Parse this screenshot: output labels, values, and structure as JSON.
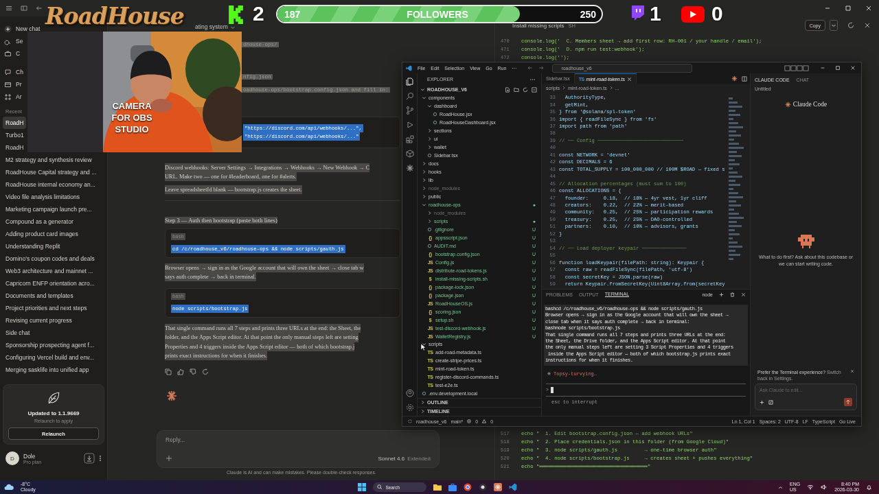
{
  "overlay": {
    "logo": "RoadHouse",
    "camera_label": "CAMERA FOR OBS STUDIO",
    "kick_count": "2",
    "followers": {
      "current": "187",
      "label": "FOLLOWERS",
      "goal": "250",
      "level": 0.748
    },
    "twitch_count": "1",
    "youtube_count": "0"
  },
  "claude": {
    "sidebar": {
      "new_chat": "New chat",
      "nav": [
        "Se",
        "C",
        "Ch",
        "Pr",
        "Ar"
      ],
      "recents_label": "Recent",
      "recents": [
        {
          "title": "RoadH",
          "selected": true
        },
        {
          "title": "Turbo1",
          "selected": false
        },
        {
          "title": "RoadH",
          "selected": false
        },
        {
          "title": "M2 strategy and synthesis review",
          "selected": false
        },
        {
          "title": "RoadHouse Capital strategy and ...",
          "selected": false
        },
        {
          "title": "RoadHouse internal economy an...",
          "selected": false
        },
        {
          "title": "Video file analysis limitations",
          "selected": false
        },
        {
          "title": "Marketing campaign launch pre...",
          "selected": false
        },
        {
          "title": "Compound as a generator",
          "selected": false
        },
        {
          "title": "Adding product card images",
          "selected": false
        },
        {
          "title": "Understanding Replit",
          "selected": false
        },
        {
          "title": "Domino's coupon codes and deals",
          "selected": false
        },
        {
          "title": "Web3 architecture and mainnet ...",
          "selected": false
        },
        {
          "title": "Capricorn ENFP orientation acro...",
          "selected": false
        },
        {
          "title": "Documents and templates",
          "selected": false
        },
        {
          "title": "Project priorities and next steps",
          "selected": false
        },
        {
          "title": "Revising current progress",
          "selected": false
        },
        {
          "title": "Side chat",
          "selected": false
        },
        {
          "title": "Sponsorship prospecting agent f...",
          "selected": false
        },
        {
          "title": "Configuring Vercel build and env...",
          "selected": false
        },
        {
          "title": "Merging sasklife into unified app",
          "selected": false
        }
      ],
      "update": {
        "title": "Updated to 1.1.9669",
        "subtitle": "Relaunch to apply",
        "button": "Relaunch"
      },
      "user": {
        "initial": "D",
        "name": "Dole",
        "plan": "Pro plan"
      }
    },
    "chat": {
      "title": "ating system",
      "blocks": [
        {
          "kind": "chip",
          "text": "dhouse-ops/"
        },
        {
          "kind": "chip",
          "text": "nfig.json"
        },
        {
          "kind": "chip",
          "text": "oadhouse-ops/bootstrap.config.json and fill in:"
        },
        {
          "kind": "code",
          "lines": [
            "\"https://discord.com/api/webhooks/...\",",
            "\"https://discord.com/api/webhooks/...\""
          ]
        },
        {
          "kind": "para",
          "lines": [
            "Discord webhooks: Server Settings → Integrations → Webhooks → New Webhook → C",
            "URL. Make two — one for #leaderboard, one for #alerts."
          ]
        },
        {
          "kind": "para",
          "lines": [
            "Leave spreadsheetId blank — bootstrap.js creates the sheet."
          ]
        },
        {
          "kind": "rule"
        },
        {
          "kind": "heading",
          "text": "Step 3 — Auth then bootstrap (paste both lines)"
        },
        {
          "kind": "code",
          "label": "bash",
          "lines": [
            "cd /c/roadhouse_v6/roadhouse-ops && node scripts/gauth.js"
          ]
        },
        {
          "kind": "para",
          "lines": [
            "Browser opens → sign in as the Google account that will own the sheet → close tab w",
            "says auth complete → back in terminal."
          ]
        },
        {
          "kind": "code",
          "label": "bash",
          "lines": [
            "node scripts/bootstrap.js"
          ]
        },
        {
          "kind": "para",
          "lines": [
            "That single command runs all 7 steps and prints three URLs at the end: the Sheet, the",
            "folder, and the Apps Script editor. At that point the only manual steps left are setting",
            "Properties and 4 triggers inside the Apps Script editor — both of which bootstrap.j",
            "prints exact instructions for when it finishes."
          ]
        }
      ],
      "reply_placeholder": "Reply...",
      "model": "Sonnet 4.6",
      "mode": "Extended",
      "disclaimer": "Claude is AI and can make mistakes. Please double-check responses."
    },
    "artifact": {
      "title": "Install missing scripts",
      "type": "SH",
      "copy": "Copy",
      "top_lines": [
        {
          "no": "470",
          "text": "console.log('  C. Members sheet → add first row: RH-001 / your handle / email');"
        },
        {
          "no": "471",
          "text": "console.log('  D. npm run test:webhook');"
        },
        {
          "no": "472",
          "text": "console.log('');"
        }
      ],
      "bottom_lines": [
        {
          "no": "517",
          "text": "echo \"  1. Edit bootstrap.config.json — add webhook URLs\""
        },
        {
          "no": "518",
          "text": "echo \"  2. Place credentials.json in this folder (from Google Cloud)\""
        },
        {
          "no": "519",
          "text": "echo \"  3. node scripts/gauth.js         → one-time browser auth\""
        },
        {
          "no": "520",
          "text": "echo \"  4. node scripts/bootstrap.js     → creates sheet + pushes everything\""
        },
        {
          "no": "521",
          "text": "echo \"════════════════════════════════════\""
        }
      ]
    }
  },
  "vscode": {
    "menu": [
      "File",
      "Edit",
      "Selection",
      "View",
      "Go",
      "Run",
      "···"
    ],
    "search": "roadhouse_v6",
    "explorer": {
      "title": "EXPLORER",
      "root": "ROADHOUSE_V6",
      "sections": [
        "OUTLINE",
        "TIMELINE"
      ],
      "tree": [
        {
          "name": "components",
          "kind": "folder",
          "expanded": true,
          "untracked": false,
          "ignored": false,
          "children": [
            {
              "name": "dashboard",
              "kind": "folder",
              "expanded": true,
              "untracked": false,
              "ignored": false,
              "children": [
                {
                  "name": "RoadHouse.jsx",
                  "kind": "file",
                  "untracked": false,
                  "ignored": false
                },
                {
                  "name": "RoadHouseDashboard.jsx",
                  "kind": "file",
                  "untracked": false,
                  "ignored": false
                }
              ]
            },
            {
              "name": "sections",
              "kind": "folder",
              "expanded": false,
              "untracked": false,
              "ignored": false
            },
            {
              "name": "ui",
              "kind": "folder",
              "expanded": false,
              "untracked": false,
              "ignored": false
            },
            {
              "name": "wallet",
              "kind": "folder",
              "expanded": false,
              "untracked": false,
              "ignored": false
            },
            {
              "name": "Sidebar.tsx",
              "kind": "file",
              "untracked": false,
              "ignored": false
            }
          ]
        },
        {
          "name": "docs",
          "kind": "folder",
          "expanded": false,
          "untracked": false,
          "ignored": false
        },
        {
          "name": "hooks",
          "kind": "folder",
          "expanded": false,
          "untracked": false,
          "ignored": false
        },
        {
          "name": "lib",
          "kind": "folder",
          "expanded": false,
          "untracked": false,
          "ignored": false
        },
        {
          "name": "node_modules",
          "kind": "folder",
          "expanded": false,
          "untracked": false,
          "ignored": true
        },
        {
          "name": "public",
          "kind": "folder",
          "expanded": false,
          "untracked": false,
          "ignored": false
        },
        {
          "name": "roadhouse-ops",
          "kind": "folder",
          "expanded": true,
          "untracked": true,
          "ignored": false,
          "decoration": "●",
          "children": [
            {
              "name": "node_modules",
              "kind": "folder",
              "expanded": false,
              "untracked": false,
              "ignored": true
            },
            {
              "name": "scripts",
              "kind": "folder",
              "expanded": false,
              "untracked": true,
              "ignored": false,
              "decoration": "●"
            },
            {
              "name": ".gitignore",
              "kind": "file",
              "untracked": true,
              "ignored": false,
              "decoration": "U"
            },
            {
              "name": "appsscript.json",
              "kind": "file",
              "badge": "{}",
              "untracked": true,
              "ignored": false,
              "decoration": "U"
            },
            {
              "name": "AUDIT.md",
              "kind": "file",
              "untracked": true,
              "ignored": false,
              "decoration": "U"
            },
            {
              "name": "bootstrap.config.json",
              "kind": "file",
              "badge": "{}",
              "untracked": true,
              "ignored": false,
              "decoration": "U"
            },
            {
              "name": "Config.js",
              "kind": "file",
              "badge": "JS",
              "untracked": true,
              "ignored": false,
              "decoration": "U"
            },
            {
              "name": "distribute-road-tokens.js",
              "kind": "file",
              "badge": "JS",
              "untracked": true,
              "ignored": false,
              "decoration": "U"
            },
            {
              "name": "install-missing-scripts.sh",
              "kind": "file",
              "badge": "$",
              "untracked": true,
              "ignored": false,
              "decoration": "U"
            },
            {
              "name": "package-lock.json",
              "kind": "file",
              "badge": "{}",
              "untracked": true,
              "ignored": false,
              "decoration": "U"
            },
            {
              "name": "package.json",
              "kind": "file",
              "badge": "{}",
              "untracked": true,
              "ignored": false,
              "decoration": "U"
            },
            {
              "name": "RoadHouseOS.js",
              "kind": "file",
              "badge": "JS",
              "untracked": true,
              "ignored": false,
              "decoration": "U"
            },
            {
              "name": "scoring.json",
              "kind": "file",
              "badge": "{}",
              "untracked": true,
              "ignored": false,
              "decoration": "U"
            },
            {
              "name": "setup.sh",
              "kind": "file",
              "badge": "$",
              "untracked": true,
              "ignored": false,
              "decoration": "U"
            },
            {
              "name": "test-discord-webhook.js",
              "kind": "file",
              "badge": "JS",
              "untracked": true,
              "ignored": false,
              "decoration": "U"
            },
            {
              "name": "WalletRegistry.js",
              "kind": "file",
              "badge": "JS",
              "untracked": true,
              "ignored": false,
              "decoration": "U"
            }
          ]
        },
        {
          "name": "scripts",
          "kind": "folder",
          "expanded": true,
          "untracked": false,
          "ignored": false,
          "children": [
            {
              "name": "add-road-metadata.ts",
              "kind": "file",
              "badge": "TS",
              "untracked": false,
              "ignored": false
            },
            {
              "name": "create-stripe-prices.ts",
              "kind": "file",
              "badge": "TS",
              "untracked": false,
              "ignored": false
            },
            {
              "name": "mint-road-token.ts",
              "kind": "file",
              "badge": "TS",
              "untracked": false,
              "ignored": false
            },
            {
              "name": "register-discord-commands.ts",
              "kind": "file",
              "badge": "TS",
              "untracked": false,
              "ignored": false
            },
            {
              "name": "test-e2e.ts",
              "kind": "file",
              "badge": "TS",
              "untracked": false,
              "ignored": false
            }
          ]
        },
        {
          "name": ".env.development.local",
          "kind": "file",
          "untracked": false,
          "ignored": false
        }
      ]
    },
    "tabs": [
      {
        "label": "Sidebar.tsx",
        "selected": false
      },
      {
        "label": "mint-road-token.ts",
        "badge": "TS",
        "selected": true
      }
    ],
    "breadcrumb": [
      "scripts",
      "mint-road-token.ts",
      "..."
    ],
    "code": [
      {
        "no": "33",
        "kind": "code",
        "text": "  AuthorityType,"
      },
      {
        "no": "34",
        "kind": "code",
        "text": "  getMint,"
      },
      {
        "no": "35",
        "kind": "code",
        "text": "} from '@solana/spl-token'"
      },
      {
        "no": "36",
        "kind": "code",
        "text": "import { readFileSync } from 'fs'"
      },
      {
        "no": "37",
        "kind": "code",
        "text": "import path from 'path'"
      },
      {
        "no": "38",
        "kind": "blank"
      },
      {
        "no": "39",
        "kind": "comment",
        "text": "// ── Config ─────────────────────────────"
      },
      {
        "no": "40",
        "kind": "blank"
      },
      {
        "no": "41",
        "kind": "code",
        "text": "const NETWORK = 'devnet'"
      },
      {
        "no": "42",
        "kind": "code",
        "text": "const DECIMALS = 6"
      },
      {
        "no": "43",
        "kind": "code",
        "text": "const TOTAL_SUPPLY = 100_000_000 // 100M $ROAD — fixed s"
      },
      {
        "no": "44",
        "kind": "blank"
      },
      {
        "no": "45",
        "kind": "comment",
        "text": "// Allocation percentages (must sum to 100)"
      },
      {
        "no": "46",
        "kind": "code",
        "text": "const ALLOCATIONS = {"
      },
      {
        "no": "47",
        "kind": "code",
        "text": "  founder:     0.18,  // 18% — 4yr vest, 1yr cliff"
      },
      {
        "no": "48",
        "kind": "code",
        "text": "  creators:    0.22,  // 22% — merit-based"
      },
      {
        "no": "49",
        "kind": "code",
        "text": "  community:   0.25,  // 25% — participation rewards"
      },
      {
        "no": "50",
        "kind": "code",
        "text": "  treasury:    0.25,  // 25% — DAO-controlled"
      },
      {
        "no": "51",
        "kind": "code",
        "text": "  partners:    0.10,  // 10% — advisors, grants"
      },
      {
        "no": "52",
        "kind": "code",
        "text": "}"
      },
      {
        "no": "53",
        "kind": "blank"
      },
      {
        "no": "54",
        "kind": "comment",
        "text": "// ── Load deployer keypair ───────────────"
      },
      {
        "no": "55",
        "kind": "blank"
      },
      {
        "no": "56",
        "kind": "code",
        "text": "function loadKeypair(filePath: string): Keypair {"
      },
      {
        "no": "57",
        "kind": "code",
        "text": "  const raw = readFileSync(filePath, 'utf-8')"
      },
      {
        "no": "58",
        "kind": "code",
        "text": "  const secretKey = JSON.parse(raw)"
      },
      {
        "no": "59",
        "kind": "code",
        "text": "  return Keypair.fromSecretKey(Uint8Array.from(secretKey"
      }
    ],
    "panel_tabs": [
      {
        "label": "PROBLEMS",
        "selected": false
      },
      {
        "label": "OUTPUT",
        "selected": false
      },
      {
        "label": "TERMINAL",
        "selected": true
      }
    ],
    "terminal_name": "node",
    "terminal": {
      "output": [
        "bashcd /c/roadhouse_v6/roadhouse-ops && node scripts/gauth.js",
        "Browser opens → sign in as the Google account that will own the sheet →",
        "close tab when it says auth complete → back in terminal:",
        "bashnode scripts/bootstrap.js",
        "That single command runs all 7 steps and prints three URLs at the end:",
        "the Sheet, the Drive folder, and the Apps Script editor. At that point",
        "the only manual steps left are setting 3 Script Properties and 4 triggers",
        " inside the Apps Script editor — both of which bootstrap.js prints exact",
        "instructions for when it finishes."
      ],
      "status": "Topsy-turvying…",
      "prompt": ">",
      "hint": "esc to interrupt"
    },
    "claude_panel": {
      "tabs": [
        {
          "label": "CLAUDE CODE",
          "selected": true
        },
        {
          "label": "CHAT",
          "selected": false
        }
      ],
      "session": "Untitled",
      "brand": "Claude Code",
      "prompt": "What to do first? Ask about this codebase or we can start writing code.",
      "banner": "**Prefer the Terminal experience?** Switch back in Settings.",
      "input_placeholder": "Ask Claude to edit..."
    },
    "status_left": [
      "roadhouse_v6",
      "main*"
    ],
    "errors": "0",
    "warnings": "0",
    "status_right": [
      "Ln 1, Col 1",
      "Spaces: 2",
      "UTF-8",
      "LF",
      "TypeScript",
      "Go Live"
    ]
  },
  "taskbar": {
    "weather": {
      "temp": "-8°C",
      "condition": "Cloudy"
    },
    "search": "Search",
    "language": "ENG",
    "region": "US",
    "time": "8:40 PM",
    "date": "2026-03-30"
  }
}
